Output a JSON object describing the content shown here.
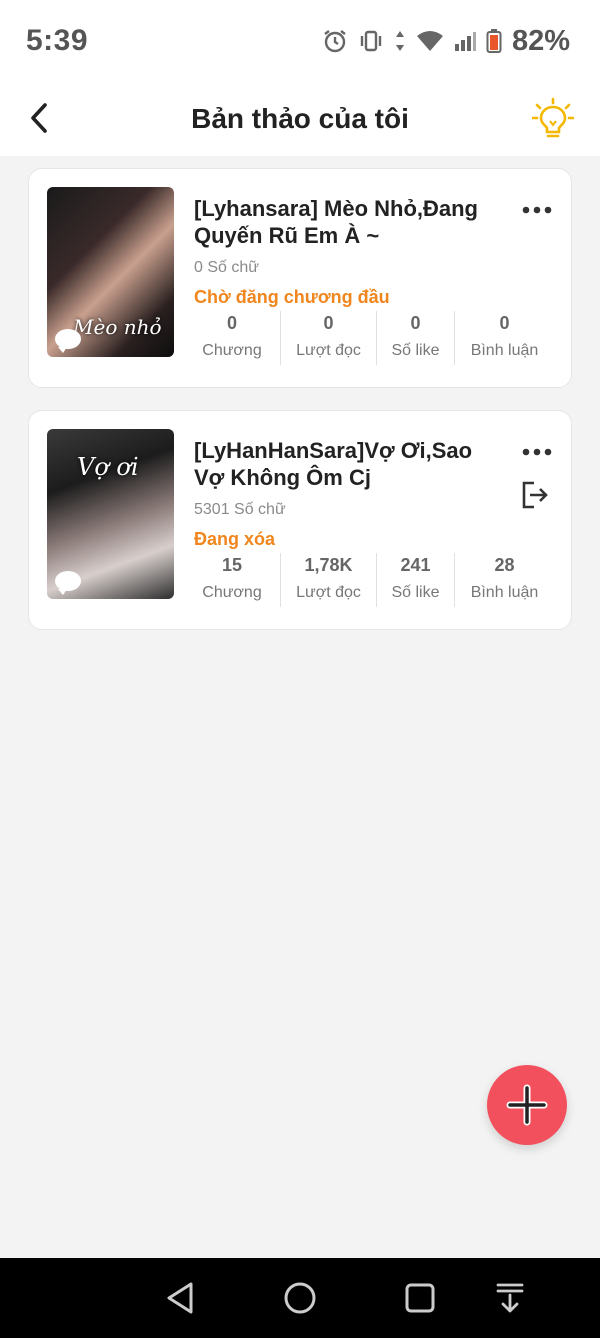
{
  "status_bar": {
    "time": "5:39",
    "battery": "82%",
    "icons": [
      "alarm-icon",
      "vibrate-icon",
      "data-arrows-icon",
      "wifi-icon",
      "signal-icon",
      "battery-icon"
    ]
  },
  "header": {
    "title": "Bản thảo của tôi",
    "back_icon": "chevron-left-icon",
    "tip_icon": "lightbulb-icon"
  },
  "books": [
    {
      "title": "[Lyhansara] Mèo Nhỏ,Đang Quyến Rũ Em À ~",
      "cover_text": "Mèo nhỏ",
      "word_count": "0 Số chữ",
      "status": "Chờ đăng chương đầu",
      "stats": [
        {
          "value": "0",
          "label": "Chương"
        },
        {
          "value": "0",
          "label": "Lượt đọc"
        },
        {
          "value": "0",
          "label": "Số like"
        },
        {
          "value": "0",
          "label": "Bình luận"
        }
      ]
    },
    {
      "title": "[LyHanHanSara]Vợ Ơi,Sao Vợ Không Ôm Cj",
      "cover_text": "Vợ ơi",
      "word_count": "5301 Số chữ",
      "status": "Đang xóa",
      "stats": [
        {
          "value": "15",
          "label": "Chương"
        },
        {
          "value": "1,78K",
          "label": "Lượt đọc"
        },
        {
          "value": "241",
          "label": "Số like"
        },
        {
          "value": "28",
          "label": "Bình luận"
        }
      ]
    }
  ],
  "colors": {
    "accent_orange": "#f0861e",
    "fab_red": "#f1505c",
    "bulb_yellow": "#f5b800",
    "background": "#f3f3f3"
  },
  "fab": {
    "icon": "plus-icon"
  },
  "nav": {
    "icons": [
      "back-triangle-icon",
      "home-circle-icon",
      "recents-square-icon",
      "notification-pull-icon"
    ]
  }
}
